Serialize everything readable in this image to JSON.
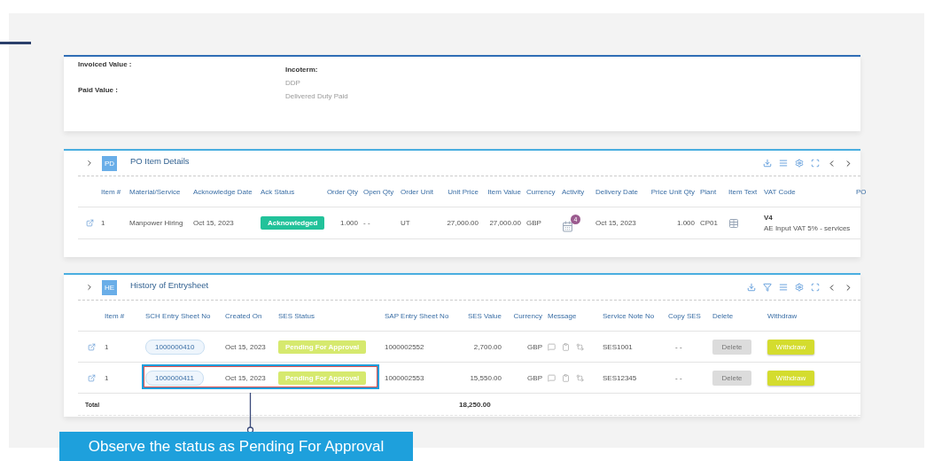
{
  "summary": {
    "fields": [
      {
        "label": "Invoiced Value :"
      },
      {
        "label": "Paid Value :"
      }
    ],
    "incoterm": {
      "label": "Incoterm:",
      "code": "DDP",
      "description": "Delivered Duty Paid"
    }
  },
  "po_items": {
    "badge": "PD",
    "title": "PO Item Details",
    "columns": [
      "Item #",
      "Material/Service",
      "Acknowledge Date",
      "Ack Status",
      "Order Qty",
      "Open Qty",
      "Order Unit",
      "Unit Price",
      "Item Value",
      "Currency",
      "Activity",
      "Delivery Date",
      "Price Unit Qty",
      "Plant",
      "Item Text",
      "VAT Code",
      "PO"
    ],
    "rows": [
      {
        "item": "1",
        "material": "Manpower Hiring",
        "ack_date": "Oct 15, 2023",
        "ack_status": "Acknowledged",
        "order_qty": "1.000",
        "open_qty": "- -",
        "order_unit": "UT",
        "unit_price": "27,000.00",
        "item_value": "27,000.00",
        "currency": "GBP",
        "activity_count": "4",
        "delivery_date": "Oct 15, 2023",
        "price_unit_qty": "1.000",
        "plant": "CP01",
        "vat_code": "V4",
        "vat_description": "AE Input VAT 5% - services"
      }
    ]
  },
  "history": {
    "badge": "HE",
    "title": "History of Entrysheet",
    "columns": [
      "Item #",
      "SCH Entry Sheet No",
      "Created On",
      "SES Status",
      "SAP Entry Sheet No",
      "SES Value",
      "Currency",
      "Message",
      "Service Note No",
      "Copy SES",
      "Delete",
      "Withdraw"
    ],
    "rows": [
      {
        "item": "1",
        "sch_no": "1000000410",
        "created_on": "Oct 15, 2023",
        "status": "Pending For Approval",
        "sap_no": "1000002552",
        "value": "2,700.00",
        "currency": "GBP",
        "service_note": "SES1001",
        "copy_ses": "- -",
        "delete": {
          "label": "Delete",
          "disabled": true
        },
        "withdraw": {
          "label": "Withdraw",
          "disabled": false
        },
        "highlighted": false
      },
      {
        "item": "1",
        "sch_no": "1000000411",
        "created_on": "Oct 15, 2023",
        "status": "Pending For Approval",
        "sap_no": "1000002553",
        "value": "15,550.00",
        "currency": "GBP",
        "service_note": "SES12345",
        "copy_ses": "- -",
        "delete": {
          "label": "Delete",
          "disabled": true
        },
        "withdraw": {
          "label": "Withdraw",
          "disabled": false
        },
        "highlighted": true
      }
    ],
    "total": {
      "label": "Total",
      "value": "18,250.00"
    }
  },
  "callout": {
    "text": "Observe the status as Pending For Approval"
  }
}
